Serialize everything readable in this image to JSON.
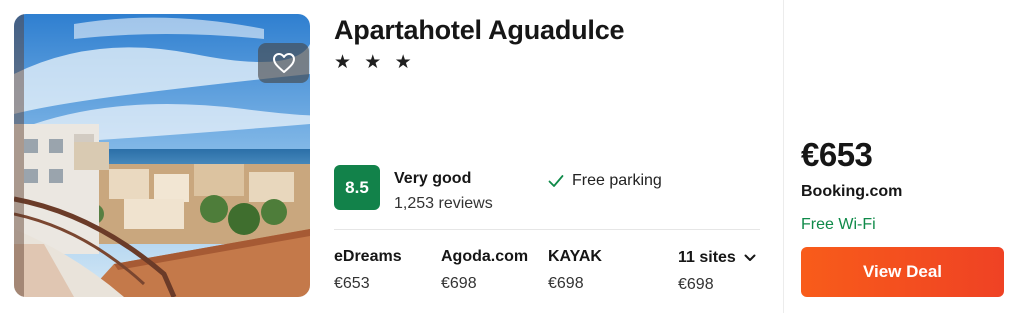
{
  "hotel": {
    "name": "Apartahotel Aguadulce",
    "stars": "★ ★ ★",
    "score": "8.5",
    "rating_label": "Very good",
    "review_count": "1,253 reviews",
    "amenity": "Free parking"
  },
  "sites": [
    {
      "name": "eDreams",
      "price": "€653"
    },
    {
      "name": "Agoda.com",
      "price": "€698"
    },
    {
      "name": "KAYAK",
      "price": "€698"
    }
  ],
  "more_sites": {
    "label": "11 sites",
    "price": "€698"
  },
  "deal": {
    "price": "€653",
    "provider": "Booking.com",
    "perk": "Free Wi-Fi",
    "button_label": "View Deal"
  },
  "colors": {
    "score_badge": "#12824a",
    "perk_text": "#0f8a49",
    "deal_button": "#f4511e"
  },
  "icons": {
    "favorite": "heart-outline-icon",
    "amenity": "check-icon",
    "expand": "chevron-down-icon"
  }
}
